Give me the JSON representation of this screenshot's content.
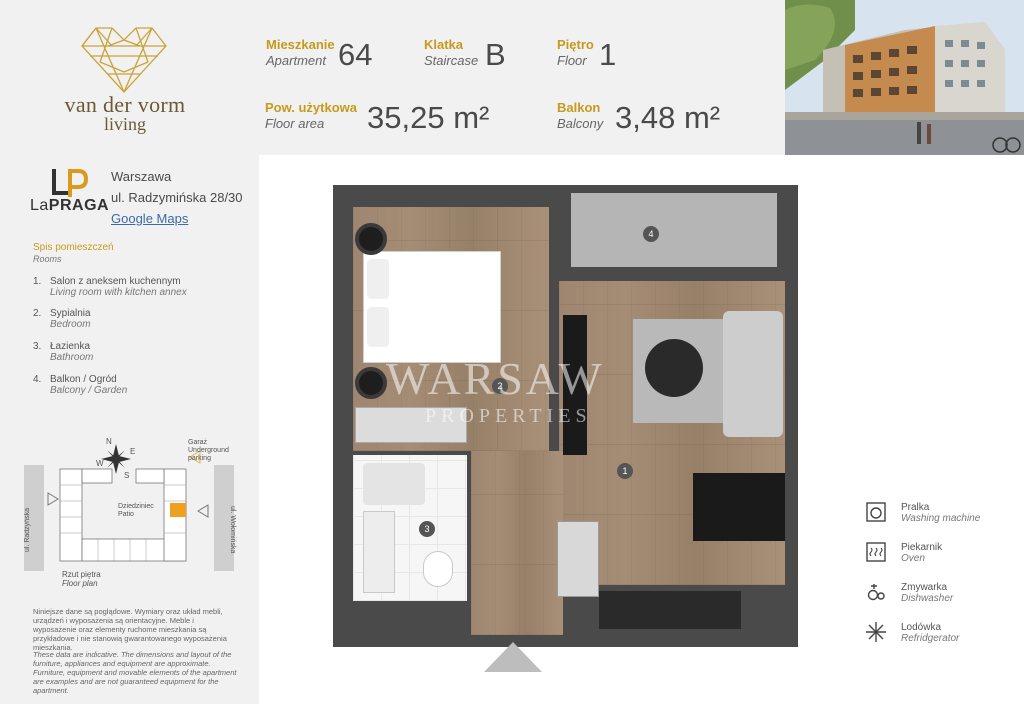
{
  "brand": {
    "line1": "van der vorm",
    "line2": "living",
    "color": "#c79a1e"
  },
  "specs": {
    "apartment": {
      "label_pl": "Mieszkanie",
      "label_en": "Apartment",
      "value": "64"
    },
    "staircase": {
      "label_pl": "Klatka",
      "label_en": "Staircase",
      "value": "B"
    },
    "floor": {
      "label_pl": "Piętro",
      "label_en": "Floor",
      "value": "1"
    },
    "area": {
      "label_pl": "Pow. użytkowa",
      "label_en": "Floor area",
      "value": "35,25 m²"
    },
    "balcony": {
      "label_pl": "Balkon",
      "label_en": "Balcony",
      "value": "3,48 m²"
    }
  },
  "project": {
    "logo_mark": "LP",
    "logo_text_a": "La",
    "logo_text_b": "PRAGA",
    "city": "Warszawa",
    "street": "ul. Radzymińska 28/30",
    "map_link": "Google Maps"
  },
  "rooms": {
    "title_pl": "Spis pomieszczeń",
    "title_en": "Rooms",
    "items": [
      {
        "num": "1.",
        "pl": "Salon z aneksem kuchennym",
        "en": "Living room with kitchen annex"
      },
      {
        "num": "2.",
        "pl": "Sypialnia",
        "en": "Bedroom"
      },
      {
        "num": "3.",
        "pl": "Łazienka",
        "en": "Bathroom"
      },
      {
        "num": "4.",
        "pl": "Balkon / Ogród",
        "en": "Balcony / Garden"
      }
    ]
  },
  "site_plan": {
    "compass": {
      "n": "N",
      "s": "S",
      "e": "E",
      "w": "W"
    },
    "garage_pl": "Garaż",
    "garage_en_1": "Underground",
    "garage_en_2": "parking",
    "courtyard_pl": "Dziedziniec",
    "courtyard_en": "Patio",
    "street_left": "ul. Radzyńska",
    "street_right": "ul. Wołomińska",
    "caption_pl": "Rzut piętra",
    "caption_en": "Floor plan",
    "highlight_color": "#f0a020"
  },
  "disclaimer": {
    "pl": "Niniejsze dane są poglądowe. Wymiary oraz układ mebli, urządzeń i wyposażenia są orientacyjne. Meble i wyposażenie oraz elementy ruchome mieszkania są przykładowe i nie stanowią gwarantowanego wyposażenia mieszkania.",
    "en": "These data are indicative. The dimensions and layout of the furniture, appliances and equipment are approximate. Furniture, equipment and movable elements of the apartment are examples and are not guaranteed equipment for the apartment."
  },
  "plan_labels": {
    "r1": "1",
    "r2": "2",
    "r3": "3",
    "r4": "4"
  },
  "watermark": {
    "line1": "WARSAW",
    "line2": "PROPERTIES"
  },
  "legend": [
    {
      "icon": "washing-machine-icon",
      "pl": "Pralka",
      "en": "Washing machine"
    },
    {
      "icon": "oven-icon",
      "pl": "Piekarnik",
      "en": "Oven"
    },
    {
      "icon": "dishwasher-icon",
      "pl": "Zmywarka",
      "en": "Dishwasher"
    },
    {
      "icon": "refrigerator-icon",
      "pl": "Lodówka",
      "en": "Refridgerator"
    }
  ]
}
